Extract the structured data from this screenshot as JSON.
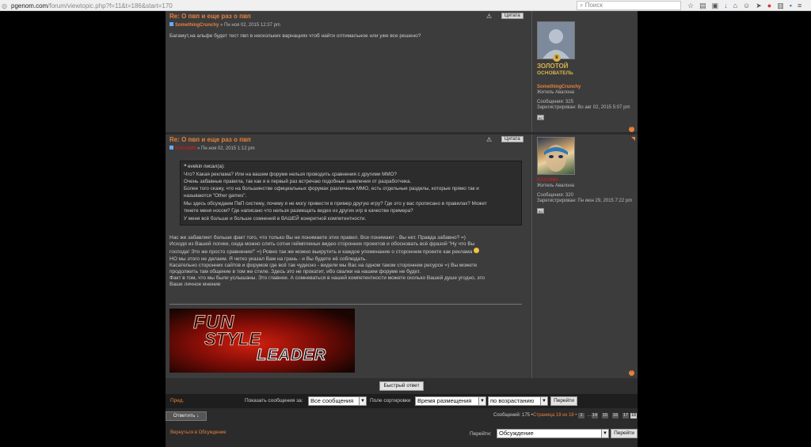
{
  "browser": {
    "url_host": "pgenom.com",
    "url_path": "/forum/viewtopic.php?f=11&t=186&start=170",
    "search_placeholder": "Поиск"
  },
  "posts": [
    {
      "title": "Re: О пвп и еще раз о пвп",
      "author": "SomethingCrunchy",
      "date": "» Пн ноя 02, 2015 12:37 pm",
      "quote_label": "Цитата",
      "text": [
        "Багамут,на альфе будет тест пвп в нескольких варнациях чтоб найти оптимальное нли уже все решено?"
      ],
      "profile": {
        "rank_line1": "ЗОЛОТОЙ",
        "rank_line2": "ОСНОВАТЕЛЬ",
        "name": "SomethingCrunchy",
        "status": "Житель Авалона",
        "messages": "Сообщения: 325",
        "registered": "Зарегистрирован: Во авг 02, 2015 5:07 pm",
        "pm": "ЛС"
      }
    },
    {
      "title": "Re: О пвп и еще раз о пвп",
      "author": "KAGANH",
      "date": "» Пн ноя 02, 2015 1:12 pm",
      "quote_label": "Цитата",
      "quote": {
        "head": "evekin писал(а):",
        "lines": [
          "Что? Какая реклама? Или на вашем форуме нельзя проводить сравнения с другими ММО?",
          "Очень забавные правила, так как я в первый раз встречаю подобные заявления от разработчика.",
          "Более того скажу, что на большинстве официальных форумах различных ММО, есть отдельные разделы, которые прямо так и",
          "называются \"Other games\".",
          "Мы здесь обсуждаем ПвП систему, почему я не могу привести в пример другую игру? Где это у вас прописано в правилах? Может",
          "ткнете меня носом? Где написано что нельзя размещать видео из других игр в качестве примера?",
          "У меня всё больше и больше сомнений в ВАШЕЙ конкретной компетентности."
        ]
      },
      "text": [
        "Нас же забавляет больше факт того, что только Вы не понимаете этих правил. Все понимают - Вы нет. Правда забавно? =)",
        "Исходя из Вашей логики, сюда можно слить сотни геймплеиых видео сторонних проектов и обосновать всё фразой \"Ну что Вы",
        "господа! Это же просто сравнение!\" =) Ровно так же можно выкрутить и каждое упоминание о стороннем проекте как реклама",
        "НО мы этого не делаем. Я четко указал Вам на грань - и Вы будете её соблюдать.",
        "Касательно сторонних сайтов и форумов где всё так чудесно - видели мы Вас на одном таком стороннем ресурсе =) Вы можете",
        "продолжить там общение в том же стиле. Здесь это не прокатит, ибо свалки на нашем форуме не будет.",
        "Факт в том, что мы были услышаны. Это главное. А сомневаться в нашей компетентности можете сколько Вашей душе угодно, это",
        "Ваше личное мнение"
      ],
      "signature": {
        "word1": "FUN",
        "word2": "STYLE",
        "word3": "LEADER"
      },
      "profile": {
        "name": "KAGANH",
        "status": "Житель Авалона",
        "messages": "Сообщения: 320",
        "registered": "Зарегистрирован: Пн июн 29, 2015 7:22 pm",
        "pm": "ЛС"
      }
    }
  ],
  "quick_reply": "Быстрый ответ",
  "controls": {
    "prev": "Пред.",
    "show_label": "Показать сообщения за:",
    "show_value": "Все сообщения",
    "sort_label": "Поле сортировки",
    "sort_value": "Время размещения",
    "order_value": "по возрастанию",
    "go": "Перейти"
  },
  "reply_button": "Ответить",
  "reply_icon": "↓",
  "pagination": {
    "summary": "Сообщений: 175 •",
    "page_label": "Страница 18 из 18 •",
    "pages": [
      "1",
      "…",
      "14",
      "15",
      "16",
      "17",
      "18"
    ],
    "current": "18"
  },
  "back_link": "Вернуться в Обсуждение",
  "jump": {
    "label": "Перейти:",
    "value": "Обсуждение",
    "go": "Перейти"
  }
}
